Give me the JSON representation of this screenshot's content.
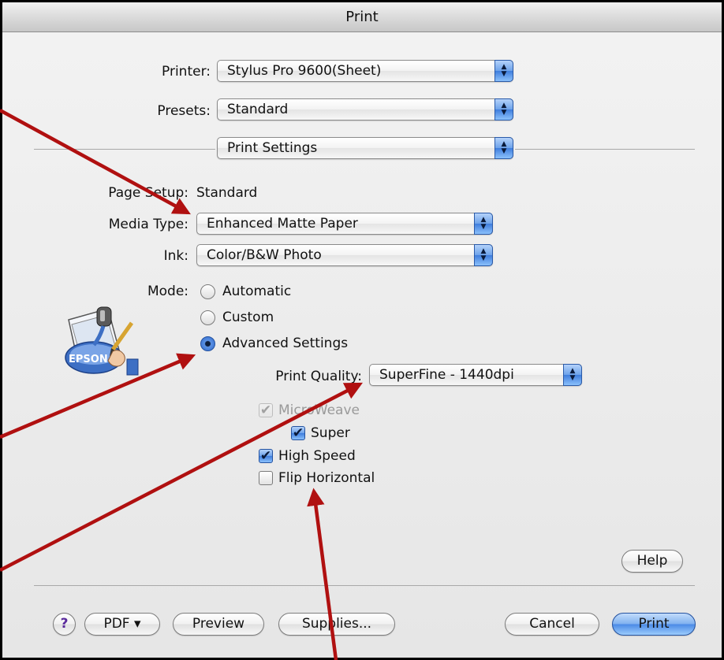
{
  "window": {
    "title": "Print"
  },
  "printer": {
    "label": "Printer:",
    "value": "Stylus Pro 9600(Sheet)"
  },
  "presets": {
    "label": "Presets:",
    "value": "Standard"
  },
  "panel": {
    "value": "Print Settings"
  },
  "page_setup": {
    "label": "Page Setup:",
    "value": "Standard"
  },
  "media_type": {
    "label": "Media Type:",
    "value": "Enhanced Matte Paper"
  },
  "ink": {
    "label": "Ink:",
    "value": "Color/B&W Photo"
  },
  "mode": {
    "label": "Mode:",
    "options": [
      "Automatic",
      "Custom",
      "Advanced Settings"
    ],
    "selected": "Advanced Settings"
  },
  "print_quality": {
    "label": "Print Quality:",
    "value": "SuperFine - 1440dpi"
  },
  "checkboxes": [
    {
      "label": "MicroWeave",
      "checked": true,
      "disabled": true
    },
    {
      "label": "Super",
      "checked": true,
      "disabled": false
    },
    {
      "label": "High Speed",
      "checked": true,
      "disabled": false
    },
    {
      "label": "Flip Horizontal",
      "checked": false,
      "disabled": false
    }
  ],
  "buttons": {
    "help": "Help",
    "question": "?",
    "pdf": "PDF ▾",
    "preview": "Preview",
    "supplies": "Supplies...",
    "cancel": "Cancel",
    "print": "Print"
  },
  "icons": {
    "epson": "EPSON"
  },
  "colors": {
    "annotation_arrow": "#b01010",
    "accent": "#3f7ddd"
  }
}
